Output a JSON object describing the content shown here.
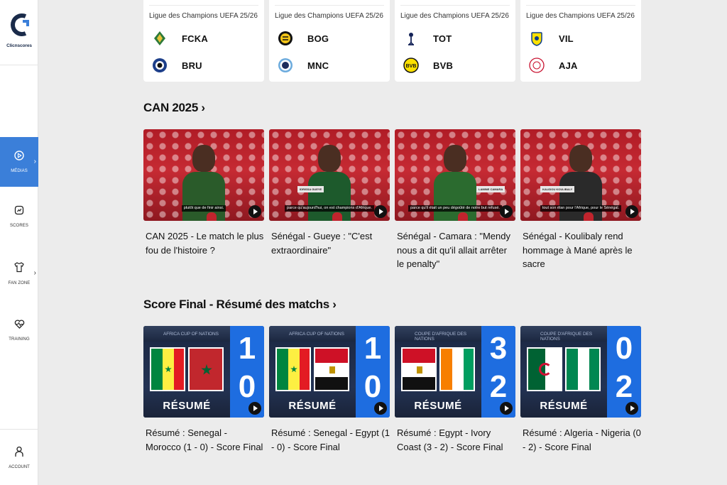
{
  "sidebar": {
    "logo_text": "Clicnscores",
    "items": [
      {
        "label": "MÉDIAS",
        "icon": "play-circle-icon",
        "active": true,
        "has_chevron": true
      },
      {
        "label": "SCORES",
        "icon": "scoreboard-icon",
        "active": false,
        "has_chevron": false
      },
      {
        "label": "FAN ZONE",
        "icon": "jersey-icon",
        "active": false,
        "has_chevron": true
      },
      {
        "label": "TRAINING",
        "icon": "heart-pulse-icon",
        "active": false,
        "has_chevron": false
      }
    ],
    "account_label": "ACCOUNT"
  },
  "matches": [
    {
      "competition": "Ligue des Champions UEFA 25/26",
      "home": "FCKA",
      "away": "BRU"
    },
    {
      "competition": "Ligue des Champions UEFA 25/26",
      "home": "BOG",
      "away": "MNC"
    },
    {
      "competition": "Ligue des Champions UEFA 25/26",
      "home": "TOT",
      "away": "BVB"
    },
    {
      "competition": "Ligue des Champions UEFA 25/26",
      "home": "VIL",
      "away": "AJA"
    }
  ],
  "sections": {
    "can": {
      "title": "CAN 2025 ›",
      "videos": [
        {
          "title": "CAN 2025 - Le match le plus fou de l'histoire ?",
          "subtitle": "plutôt que de finir ainsi.",
          "lower_third": ""
        },
        {
          "title": "Sénégal - Gueye : \"C'est extraordinaire\"",
          "subtitle": "parce qu'aujourd'hui, on est champions d'Afrique.",
          "lower_third": "IDRISSA GUEYE"
        },
        {
          "title": "Sénégal - Camara : \"Mendy nous a dit qu'il allait arrêter le penalty\"",
          "subtitle": "parce qu'il était un peu dégoûté de notre but refusé.",
          "lower_third": "LAMINE CAMARA"
        },
        {
          "title": "Sénégal - Koulibaly rend hommage à Mané après le sacre",
          "subtitle": "tout son élan pour l'Afrique, pour le Sénégal.",
          "lower_third": "KALIDOU KOULIBALY"
        }
      ]
    },
    "final": {
      "title": "Score Final - Résumé des matchs ›",
      "resume_label": "RÉSUMÉ",
      "videos": [
        {
          "title": "Résumé : Senegal - Morocco (1 - 0) - Score Final",
          "banner": "AFRICA CUP OF NATIONS",
          "home_score": "1",
          "away_score": "0",
          "home_flag": "senegal",
          "away_flag": "morocco"
        },
        {
          "title": "Résumé : Senegal - Egypt (1 - 0) - Score Final",
          "banner": "AFRICA CUP OF NATIONS",
          "home_score": "1",
          "away_score": "0",
          "home_flag": "senegal",
          "away_flag": "egypt"
        },
        {
          "title": "Résumé : Egypt - Ivory Coast (3 - 2) - Score Final",
          "banner": "COUPE D'AFRIQUE DES NATIONS",
          "home_score": "3",
          "away_score": "2",
          "home_flag": "egypt",
          "away_flag": "ivory-coast"
        },
        {
          "title": "Résumé : Algeria - Nigeria (0 - 2) - Score Final",
          "banner": "COUPE D'AFRIQUE DES NATIONS",
          "home_score": "0",
          "away_score": "2",
          "home_flag": "algeria",
          "away_flag": "nigeria"
        }
      ]
    }
  },
  "colors": {
    "accent": "#3b7fd9",
    "score_panel": "#1e6de0"
  }
}
